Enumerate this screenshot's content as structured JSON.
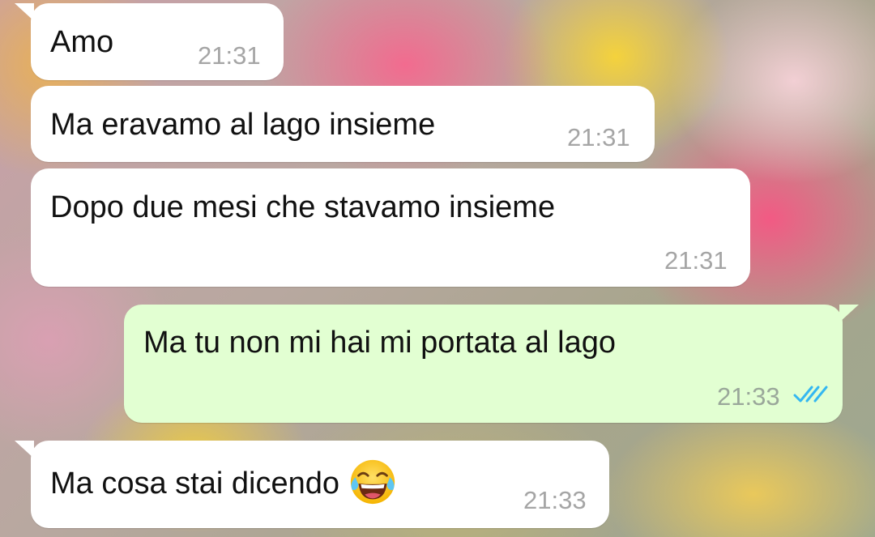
{
  "colors": {
    "incoming_bubble": "#ffffff",
    "outgoing_bubble": "#e2ffd2",
    "read_receipt": "#34b7f1",
    "timestamp": "#a5a5a5"
  },
  "messages": [
    {
      "direction": "incoming",
      "text": "Amo",
      "time": "21:31"
    },
    {
      "direction": "incoming",
      "text": "Ma eravamo al lago insieme",
      "time": "21:31"
    },
    {
      "direction": "incoming",
      "text": "Dopo due mesi che stavamo insieme",
      "time": "21:31"
    },
    {
      "direction": "outgoing",
      "text": "Ma tu non mi hai mi portata al lago",
      "time": "21:33",
      "status_icon": "double-check-read-icon"
    },
    {
      "direction": "incoming",
      "text": "Ma cosa stai dicendo",
      "emoji": "face-with-tears-of-joy",
      "time": "21:33"
    }
  ]
}
